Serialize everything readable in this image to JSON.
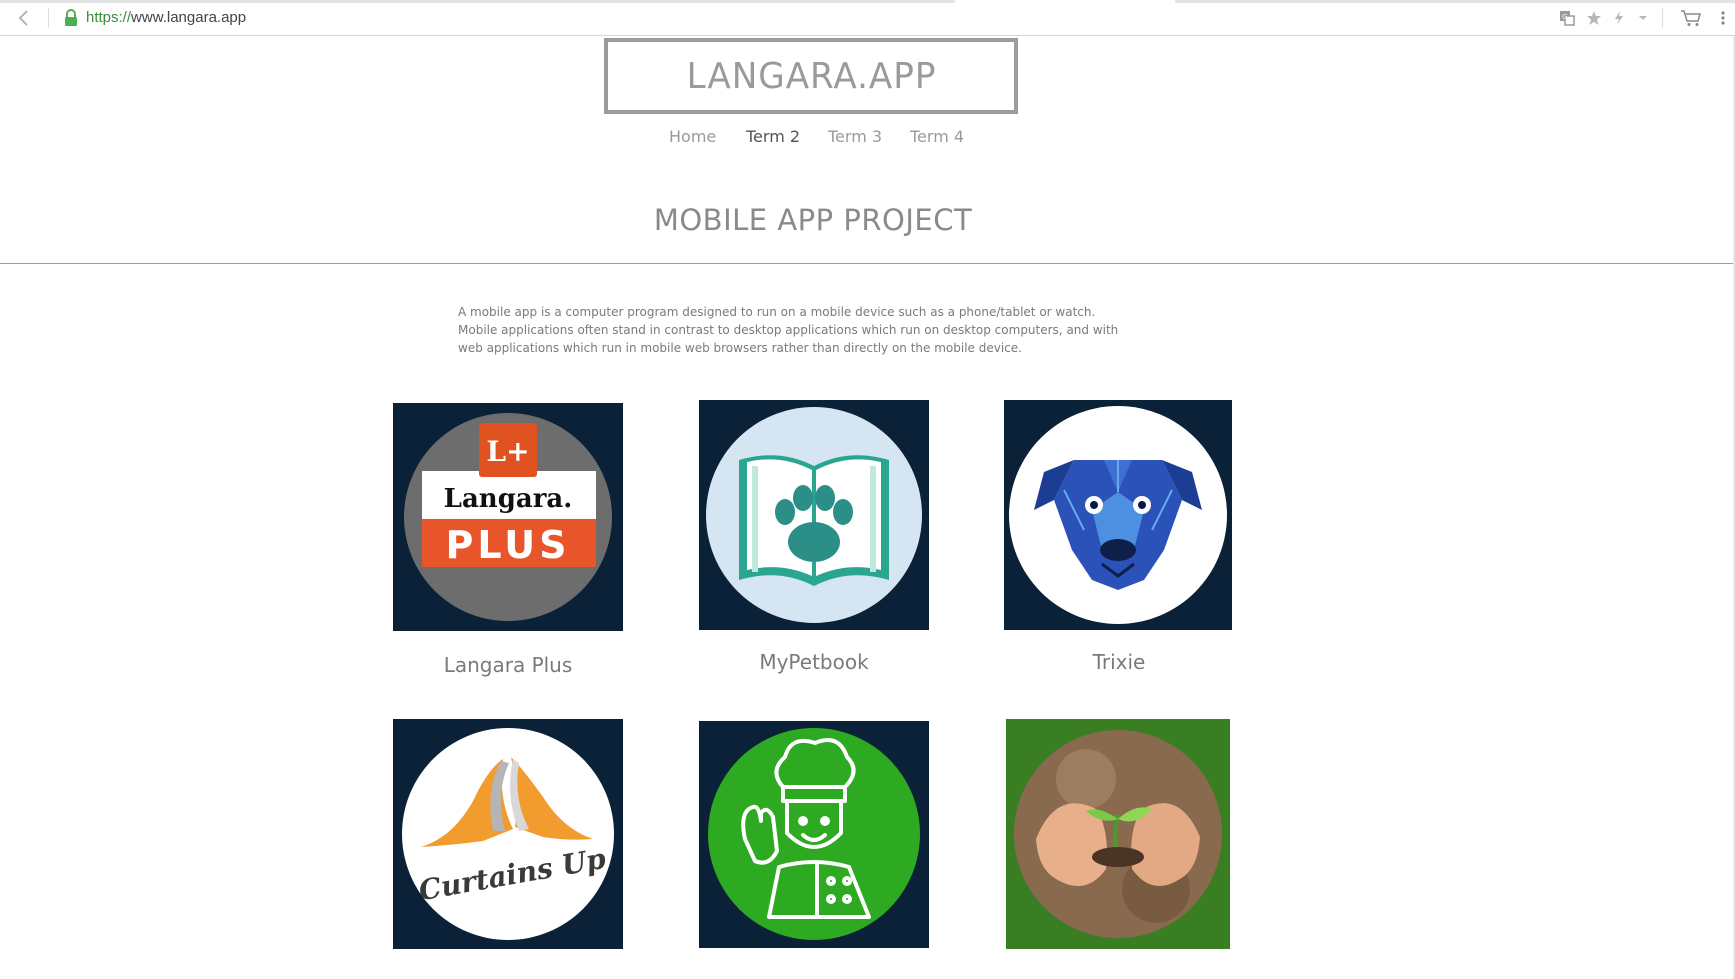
{
  "browser": {
    "url_scheme": "https://",
    "url_host": "www.langara.app",
    "icons": [
      "back-arrow-icon",
      "lock-icon",
      "translate-icon",
      "star-icon",
      "lightning-icon",
      "dropdown-icon",
      "cart-icon",
      "menu-dots-icon"
    ]
  },
  "site": {
    "logo": "LANGARA.APP",
    "nav": [
      "Home",
      "Term 2",
      "Term 3",
      "Term 4"
    ],
    "nav_active": "Term 2"
  },
  "section": {
    "title": "MOBILE APP PROJECT",
    "description": [
      "A mobile app is a computer program designed to run on a mobile device such as a phone/tablet or watch.",
      "Mobile applications often stand in contrast to desktop applications which run on desktop computers, and with",
      "web applications which run in mobile web browsers rather than directly on the mobile device."
    ]
  },
  "apps": [
    {
      "name": "Langara Plus",
      "logo_text_1": "L+",
      "logo_text_2": "Langara.",
      "logo_text_3": "PLUS"
    },
    {
      "name": "MyPetbook"
    },
    {
      "name": "Trixie"
    },
    {
      "name": "",
      "logo_text_1": "Curtains Up"
    },
    {
      "name": ""
    },
    {
      "name": ""
    }
  ],
  "colors": {
    "tile_bg": "#0a2138",
    "accent_orange": "#e8552a",
    "secure_green": "#4caf50"
  }
}
